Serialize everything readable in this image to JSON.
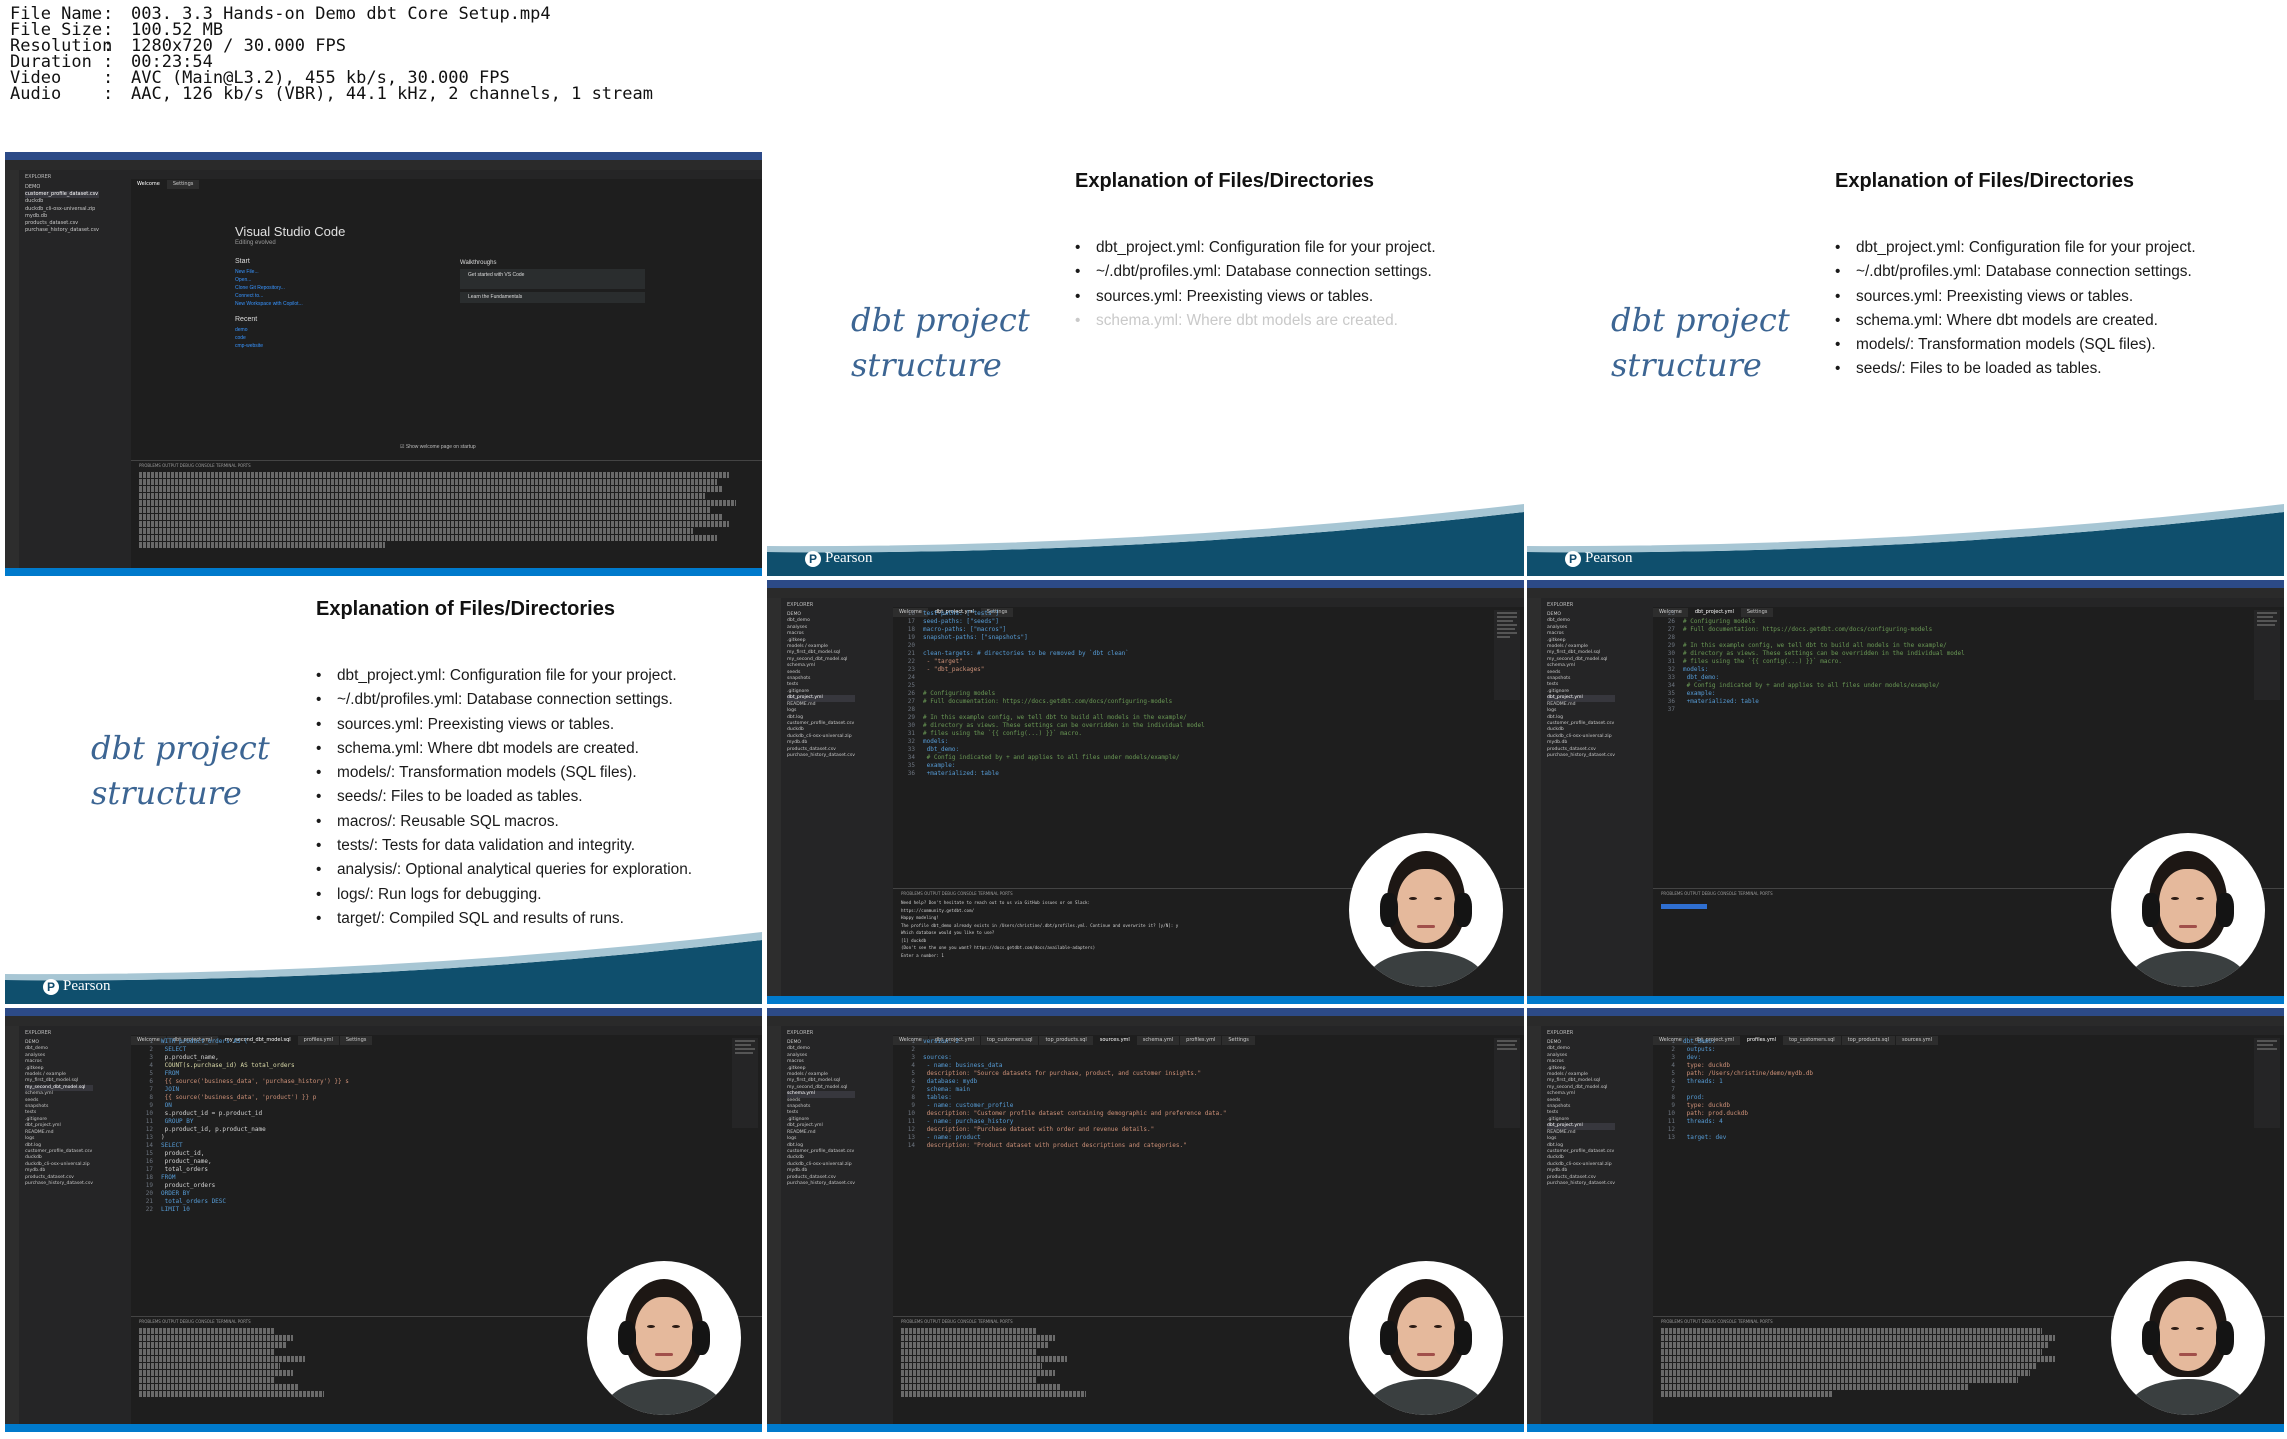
{
  "header": {
    "rows": [
      {
        "key": "File Name",
        "value": "003. 3.3 Hands-on Demo dbt Core Setup.mp4"
      },
      {
        "key": "File Size",
        "value": "100.52 MB"
      },
      {
        "key": "Resolution",
        "value": "1280x720 / 30.000 FPS"
      },
      {
        "key": "Duration",
        "value": "00:23:54"
      },
      {
        "key": "Video",
        "value": "AVC (Main@L3.2), 455 kb/s, 30.000 FPS"
      },
      {
        "key": "Audio",
        "value": "AAC, 126 kb/s (VBR), 44.1 kHz, 2 channels, 1 stream"
      }
    ]
  },
  "slide": {
    "title": "Explanation of Files/Directories",
    "left_text_1": "dbt project",
    "left_text_2": "structure",
    "logo": "Pearson",
    "bullets": [
      "dbt_project.yml: Configuration file for your project.",
      "~/.dbt/profiles.yml: Database connection settings.",
      "sources.yml: Preexisting views or tables.",
      "schema.yml: Where dbt models are created.",
      "models/: Transformation models (SQL files).",
      "seeds/: Files to be loaded as tables.",
      "macros/: Reusable SQL macros.",
      "tests/: Tests for data validation and integrity.",
      "analysis/: Optional analytical queries for exploration.",
      "logs/: Run logs for debugging.",
      "target/: Compiled SQL and results of runs."
    ]
  },
  "vscode": {
    "welcome_title": "Visual Studio Code",
    "welcome_sub": "Editing evolved",
    "start": "Start",
    "recent": "Recent",
    "walkthroughs": "Walkthroughs",
    "start_items": [
      "New File...",
      "Open...",
      "Clone Git Repository...",
      "Connect to...",
      "New Workspace with Copilot..."
    ],
    "recent_items": [
      "demo",
      "code",
      "cmp-website"
    ],
    "walk_items": [
      "Get started with VS Code",
      "Learn the Fundamentals"
    ],
    "show_welcome": "Show welcome page on startup",
    "explorer": "EXPLORER",
    "tabs_welcome": [
      "Welcome",
      "Settings"
    ],
    "tabs_project": [
      "Welcome",
      "dbt_project.yml",
      "Settings"
    ],
    "tabs_model": [
      "Welcome",
      "dbt_project.yml",
      "my_second_dbt_model.sql",
      "profiles.yml",
      "Settings"
    ],
    "tabs_sources": [
      "Welcome",
      "dbt_project.yml",
      "top_customers.sql",
      "top_products.sql",
      "sources.yml",
      "schema.yml",
      "profiles.yml",
      "Settings"
    ],
    "tabs_profiles": [
      "Welcome",
      "dbt_project.yml",
      "profiles.yml",
      "top_customers.sql",
      "top_products.sql",
      "sources.yml"
    ],
    "files_welcome": [
      "DEMO",
      "customer_profile_dataset.csv",
      "duckdb",
      "duckdb_cli-osx-universal.zip",
      "mydb.db",
      "products_dataset.csv",
      "purchase_history_dataset.csv"
    ],
    "files_project": [
      "DEMO",
      "dbt_demo",
      "analyses",
      "macros",
      ".gitkeep",
      "models / example",
      "my_first_dbt_model.sql",
      "my_second_dbt_model.sql",
      "schema.yml",
      "seeds",
      "snapshots",
      "tests",
      ".gitignore",
      "dbt_project.yml",
      "README.md",
      "logs",
      "dbt.log",
      "customer_profile_dataset.csv",
      "duckdb",
      "duckdb_cli-osx-universal.zip",
      "mydb.db",
      "products_dataset.csv",
      "purchase_history_dataset.csv"
    ],
    "code_project": [
      {
        "n": "16",
        "t": "test-paths: [\"tests\"]"
      },
      {
        "n": "17",
        "t": "seed-paths: [\"seeds\"]"
      },
      {
        "n": "18",
        "t": "macro-paths: [\"macros\"]"
      },
      {
        "n": "19",
        "t": "snapshot-paths: [\"snapshots\"]"
      },
      {
        "n": "20",
        "t": ""
      },
      {
        "n": "21",
        "t": "clean-targets:         # directories to be removed by `dbt clean`"
      },
      {
        "n": "22",
        "t": "  - \"target\""
      },
      {
        "n": "23",
        "t": "  - \"dbt_packages\""
      },
      {
        "n": "24",
        "t": ""
      },
      {
        "n": "25",
        "t": ""
      },
      {
        "n": "26",
        "t": "# Configuring models"
      },
      {
        "n": "27",
        "t": "# Full documentation: https://docs.getdbt.com/docs/configuring-models"
      },
      {
        "n": "28",
        "t": ""
      },
      {
        "n": "29",
        "t": "# In this example config, we tell dbt to build all models in the example/"
      },
      {
        "n": "30",
        "t": "# directory as views. These settings can be overridden in the individual model"
      },
      {
        "n": "31",
        "t": "# files using the `{{ config(...) }}` macro."
      },
      {
        "n": "32",
        "t": "models:"
      },
      {
        "n": "33",
        "t": "  dbt_demo:"
      },
      {
        "n": "34",
        "t": "    # Config indicated by + and applies to all files under models/example/"
      },
      {
        "n": "35",
        "t": "    example:"
      },
      {
        "n": "36",
        "t": "      +materialized: table"
      }
    ],
    "code_model": [
      {
        "n": "1",
        "t": "WITH product_orders AS ("
      },
      {
        "n": "2",
        "t": "  SELECT"
      },
      {
        "n": "3",
        "t": "      p.product_name,"
      },
      {
        "n": "4",
        "t": "      COUNT(s.purchase_id) AS total_orders"
      },
      {
        "n": "5",
        "t": "  FROM"
      },
      {
        "n": "6",
        "t": "      {{ source('business_data', 'purchase_history') }} s"
      },
      {
        "n": "7",
        "t": "  JOIN"
      },
      {
        "n": "8",
        "t": "      {{ source('business_data', 'product') }} p"
      },
      {
        "n": "9",
        "t": "  ON"
      },
      {
        "n": "10",
        "t": "      s.product_id = p.product_id"
      },
      {
        "n": "11",
        "t": "  GROUP BY"
      },
      {
        "n": "12",
        "t": "      p.product_id, p.product_name"
      },
      {
        "n": "13",
        "t": ")"
      },
      {
        "n": "14",
        "t": "SELECT"
      },
      {
        "n": "15",
        "t": "    product_id,"
      },
      {
        "n": "16",
        "t": "    product_name,"
      },
      {
        "n": "17",
        "t": "    total_orders"
      },
      {
        "n": "18",
        "t": "FROM"
      },
      {
        "n": "19",
        "t": "    product_orders"
      },
      {
        "n": "20",
        "t": "ORDER BY"
      },
      {
        "n": "21",
        "t": "    total_orders DESC"
      },
      {
        "n": "22",
        "t": "LIMIT 10"
      }
    ],
    "code_sources": [
      {
        "n": "1",
        "t": "version: 2"
      },
      {
        "n": "2",
        "t": ""
      },
      {
        "n": "3",
        "t": "sources:"
      },
      {
        "n": "4",
        "t": "  - name: business_data"
      },
      {
        "n": "5",
        "t": "    description: \"Source datasets for purchase, product, and customer insights.\""
      },
      {
        "n": "6",
        "t": "    database: mydb"
      },
      {
        "n": "7",
        "t": "    schema: main"
      },
      {
        "n": "8",
        "t": "    tables:"
      },
      {
        "n": "9",
        "t": "      - name: customer_profile"
      },
      {
        "n": "10",
        "t": "        description: \"Customer profile dataset containing demographic and preference data.\""
      },
      {
        "n": "11",
        "t": "      - name: purchase_history"
      },
      {
        "n": "12",
        "t": "        description: \"Purchase dataset with order and revenue details.\""
      },
      {
        "n": "13",
        "t": "      - name: product"
      },
      {
        "n": "14",
        "t": "        description: \"Product dataset with product descriptions and categories.\""
      }
    ],
    "code_profiles": [
      {
        "n": "1",
        "t": "dbt_demo:"
      },
      {
        "n": "2",
        "t": "  outputs:"
      },
      {
        "n": "3",
        "t": "    dev:"
      },
      {
        "n": "4",
        "t": "      type: duckdb"
      },
      {
        "n": "5",
        "t": "      path: /Users/christine/demo/mydb.db"
      },
      {
        "n": "6",
        "t": "      threads: 1"
      },
      {
        "n": "7",
        "t": ""
      },
      {
        "n": "8",
        "t": "    prod:"
      },
      {
        "n": "9",
        "t": "      type: duckdb"
      },
      {
        "n": "10",
        "t": "      path: prod.duckdb"
      },
      {
        "n": "11",
        "t": "      threads: 4"
      },
      {
        "n": "12",
        "t": ""
      },
      {
        "n": "13",
        "t": "  target: dev"
      }
    ],
    "code_project_tail": [
      {
        "n": "25",
        "t": ""
      },
      {
        "n": "26",
        "t": "# Configuring models"
      },
      {
        "n": "27",
        "t": "# Full documentation: https://docs.getdbt.com/docs/configuring-models"
      },
      {
        "n": "28",
        "t": ""
      },
      {
        "n": "29",
        "t": "# In this example config, we tell dbt to build all models in the example/"
      },
      {
        "n": "30",
        "t": "# directory as views. These settings can be overridden in the individual model"
      },
      {
        "n": "31",
        "t": "# files using the `{{ config(...) }}` macro."
      },
      {
        "n": "32",
        "t": "models:"
      },
      {
        "n": "33",
        "t": "  dbt_demo:"
      },
      {
        "n": "34",
        "t": "    # Config indicated by + and applies to all files under models/example/"
      },
      {
        "n": "35",
        "t": "    example:"
      },
      {
        "n": "36",
        "t": "      +materialized: table"
      },
      {
        "n": "37",
        "t": ""
      }
    ],
    "term_project": [
      "Need help? Don't hesitate to reach out to us via GitHub issues or on Slack:",
      "  https://community.getdbt.com/",
      "Happy modeling!",
      "The profile dbt_demo already exists in /Users/christine/.dbt/profiles.yml. Continue and overwrite it? [y/N]: y",
      "Which database would you like to use?",
      "[1] duckdb",
      "(Don't see the one you want? https://docs.getdbt.com/docs/available-adapters)",
      "Enter a number: 1"
    ],
    "panel_tabs": "PROBLEMS   OUTPUT   DEBUG CONSOLE   TERMINAL   PORTS",
    "outline": "OUTLINE",
    "timeline": "TIMELINE"
  },
  "colors": {
    "slide_title": "#111111",
    "slide_left": "#3c6593",
    "pearson_teal": "#0f4f6d",
    "vscode_bg": "#1e1e1e",
    "status_bar": "#007acc",
    "mac_bar": "#2c4a87"
  }
}
